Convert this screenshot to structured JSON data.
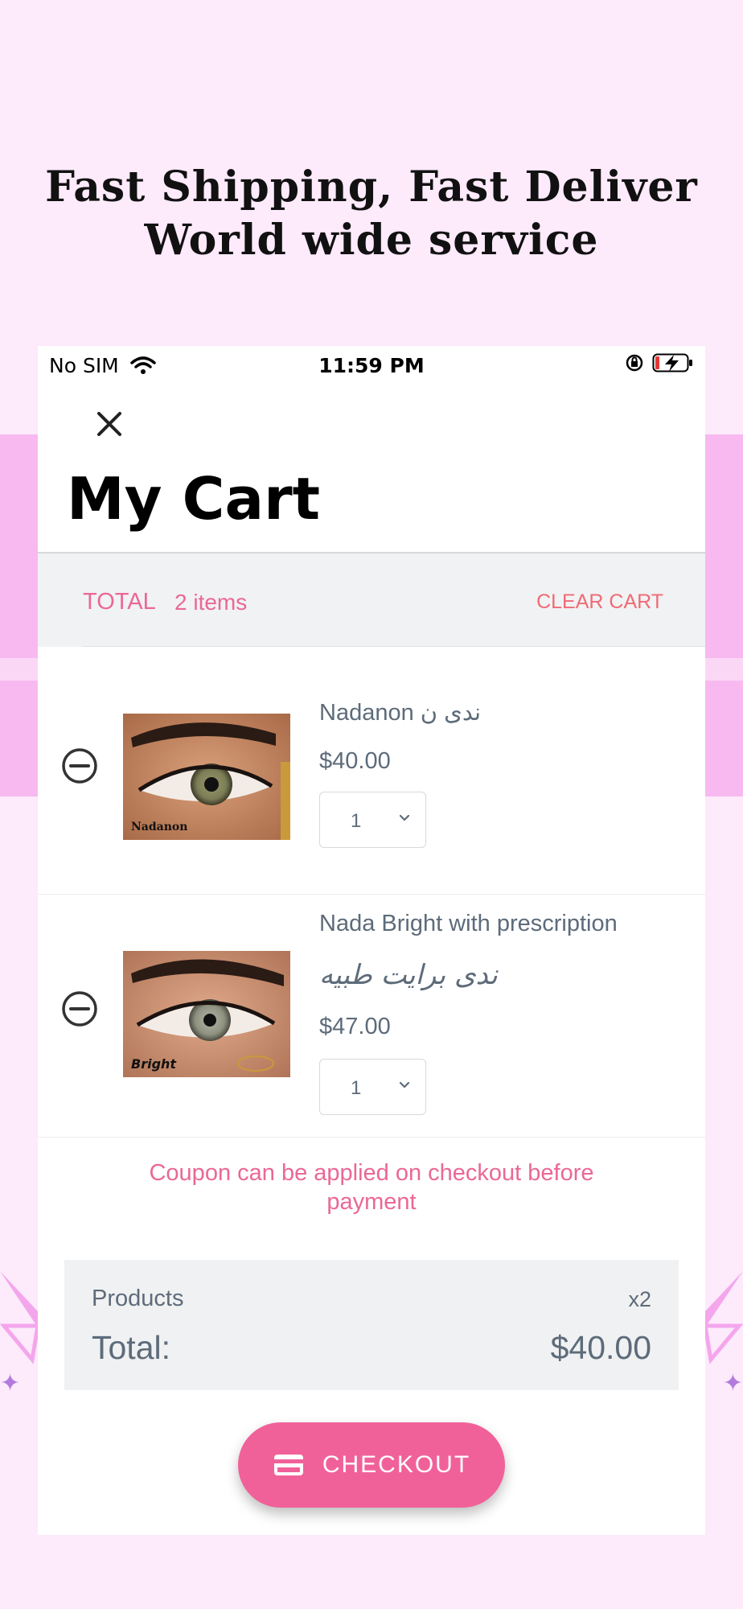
{
  "banner": {
    "line1": "Fast Shipping, Fast Deliver",
    "line2": "World wide service"
  },
  "status_bar": {
    "carrier": "No SIM",
    "time": "11:59 PM"
  },
  "header": {
    "title": "My Cart"
  },
  "total_bar": {
    "label": "TOTAL",
    "count": "2 items",
    "clear_label": "CLEAR CART"
  },
  "items": [
    {
      "name": "Nadanon ندى ن",
      "name_ar": "",
      "price": "$40.00",
      "quantity": "1",
      "image_caption": "Nadanon"
    },
    {
      "name": "Nada Bright with prescription",
      "name_ar": "ندى برايت طبيه",
      "price": "$47.00",
      "quantity": "1",
      "image_caption": "Bright"
    }
  ],
  "coupon_note": "Coupon can be applied on checkout before payment",
  "summary": {
    "products_label": "Products",
    "products_count": "x2",
    "total_label": "Total:",
    "total_value": "$40.00"
  },
  "checkout": {
    "label": "CHECKOUT",
    "icon": "credit-card-icon"
  },
  "colors": {
    "accent": "#f0619a",
    "text_pink": "#ea6896",
    "clear_red": "#ef6b75",
    "muted_text": "#5d6b7a",
    "background": "#fdeafb"
  }
}
